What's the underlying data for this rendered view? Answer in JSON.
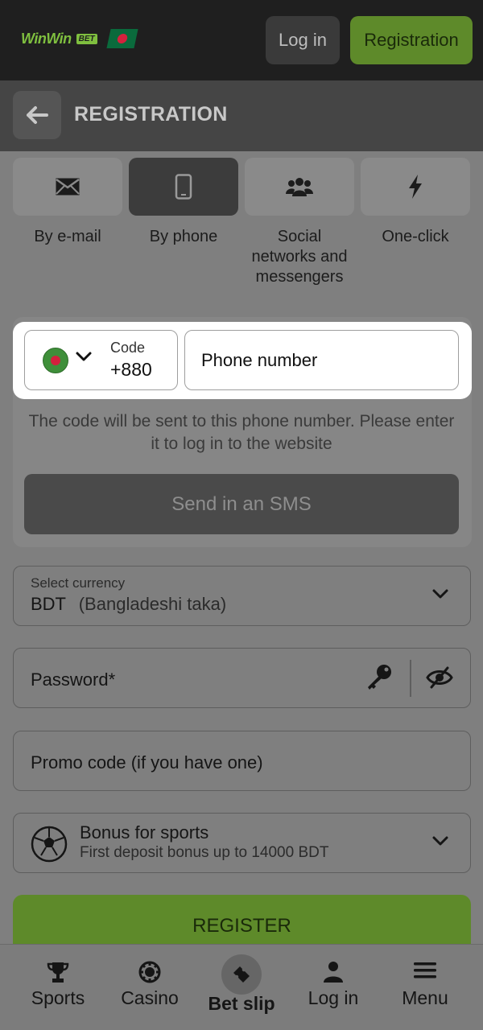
{
  "header": {
    "logo_text": "WinWin",
    "logo_badge": "BET",
    "login_label": "Log in",
    "registration_label": "Registration",
    "brand_color": "#7fbf3f"
  },
  "page": {
    "title": "REGISTRATION"
  },
  "methods": [
    {
      "label": "By e-mail",
      "icon": "envelope-icon"
    },
    {
      "label": "By phone",
      "icon": "phone-icon",
      "active": true
    },
    {
      "label": "Social networks and messengers",
      "icon": "people-icon"
    },
    {
      "label": "One-click",
      "icon": "lightning-icon"
    }
  ],
  "phone": {
    "code_label": "Code",
    "code_value": "+880",
    "number_placeholder": "Phone number",
    "hint": "The code will be sent to this phone number. Please enter it to log in to the website",
    "sms_button": "Send in an SMS"
  },
  "currency": {
    "label": "Select currency",
    "code": "BDT",
    "name": "(Bangladeshi taka)"
  },
  "password": {
    "placeholder": "Password*"
  },
  "promo": {
    "placeholder": "Promo code (if you have one)"
  },
  "bonus": {
    "title": "Bonus for sports",
    "subtitle": "First deposit bonus up to 14000 BDT"
  },
  "register_button": "REGISTER",
  "bottom_nav": [
    {
      "label": "Sports",
      "icon": "trophy-icon"
    },
    {
      "label": "Casino",
      "icon": "chip-icon"
    },
    {
      "label": "Bet slip",
      "icon": "ticket-icon",
      "active": true
    },
    {
      "label": "Log in",
      "icon": "user-icon"
    },
    {
      "label": "Menu",
      "icon": "hamburger-icon"
    }
  ]
}
